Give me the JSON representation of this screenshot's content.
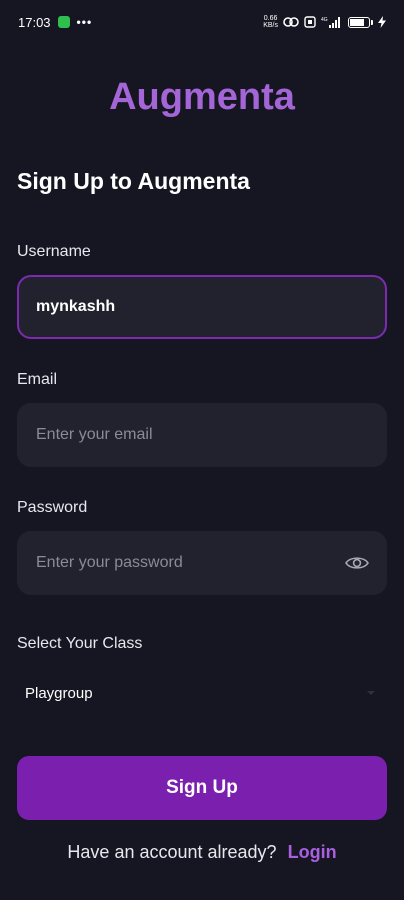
{
  "status_bar": {
    "time": "17:03",
    "more_dots": "•••",
    "net_speed_value": "0.66",
    "net_speed_unit": "KB/s",
    "network_type": "4G"
  },
  "app": {
    "logo_text": "Augmenta",
    "page_title": "Sign Up to Augmenta"
  },
  "form": {
    "username": {
      "label": "Username",
      "value": "mynkashh",
      "placeholder": ""
    },
    "email": {
      "label": "Email",
      "value": "",
      "placeholder": "Enter your email"
    },
    "password": {
      "label": "Password",
      "value": "",
      "placeholder": "Enter your password"
    },
    "class_select": {
      "label": "Select Your Class",
      "selected": "Playgroup"
    }
  },
  "actions": {
    "signup_label": "Sign Up",
    "footer_prompt": "Have an account already?",
    "login_label": "Login"
  },
  "icons": {
    "eye": "eye-icon",
    "chat": "chat-icon",
    "battery": "battery-icon",
    "signal": "signal-icon",
    "wifi": "wifi-icon"
  },
  "colors": {
    "background": "#161622",
    "brand": "#a466d6",
    "input_bg": "#22222f",
    "focus_border": "#7c2ab0",
    "button": "#7a1fae",
    "link": "#a85fe0"
  },
  "battery_level": 0.75
}
